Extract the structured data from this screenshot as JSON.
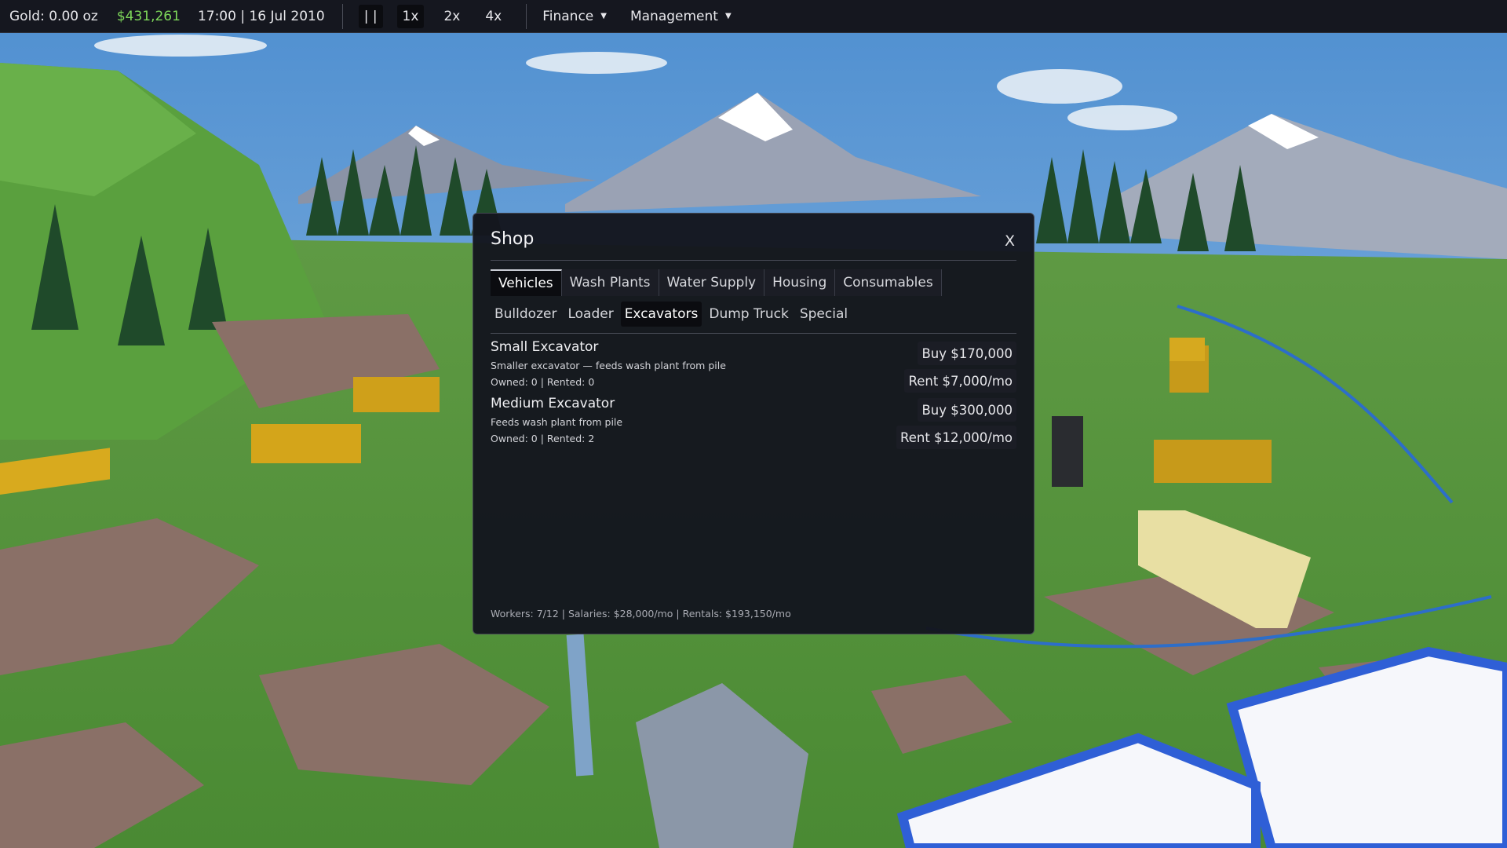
{
  "topbar": {
    "gold": "Gold: 0.00 oz",
    "money": "$431,261",
    "datetime": "17:00 | 16 Jul 2010",
    "pause_label": "| |",
    "speed_options": [
      "1x",
      "2x",
      "4x"
    ],
    "active_speed": "1x",
    "menus": [
      {
        "label": "Finance",
        "caret_icon": "caret-down-icon"
      },
      {
        "label": "Management",
        "caret_icon": "caret-down-icon"
      }
    ],
    "money_color": "#7ed85a"
  },
  "shop": {
    "title": "Shop",
    "close_label": "X",
    "tabs": [
      "Vehicles",
      "Wash Plants",
      "Water Supply",
      "Housing",
      "Consumables"
    ],
    "active_tab": "Vehicles",
    "subtabs": [
      "Bulldozer",
      "Loader",
      "Excavators",
      "Dump Truck",
      "Special"
    ],
    "active_subtab": "Excavators",
    "products": [
      {
        "name": "Small Excavator",
        "description": "Smaller excavator — feeds wash plant from pile",
        "stats": "Owned: 0 | Rented: 0",
        "buy_label": "Buy $170,000",
        "rent_label": "Rent $7,000/mo"
      },
      {
        "name": "Medium Excavator",
        "description": "Feeds wash plant from pile",
        "stats": "Owned: 0 | Rented: 2",
        "buy_label": "Buy $300,000",
        "rent_label": "Rent $12,000/mo"
      }
    ],
    "footer": "Workers: 7/12 | Salaries: $28,000/mo | Rentals: $193,150/mo"
  }
}
